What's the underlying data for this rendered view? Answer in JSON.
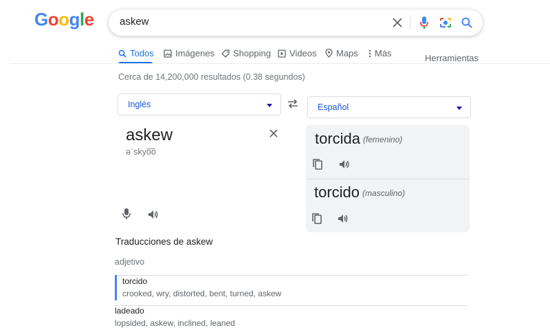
{
  "logo": {
    "letters": [
      "G",
      "o",
      "o",
      "g",
      "l",
      "e"
    ],
    "colors": [
      "#4285f4",
      "#ea4335",
      "#fbbc05",
      "#4285f4",
      "#34a853",
      "#ea4335"
    ]
  },
  "search": {
    "query": "askew",
    "icons": [
      "clear-icon",
      "mic-icon",
      "lens-icon",
      "search-icon"
    ]
  },
  "tabs": [
    {
      "label": "Todos",
      "icon": "search-icon",
      "active": true
    },
    {
      "label": "Imágenes",
      "icon": "image-icon"
    },
    {
      "label": "Shopping",
      "icon": "tag-icon"
    },
    {
      "label": "Videos",
      "icon": "play-icon"
    },
    {
      "label": "Maps",
      "icon": "pin-icon"
    },
    {
      "label": "Más",
      "icon": "more-vert-icon"
    }
  ],
  "tools_label": "Herramientas",
  "result_stats": "Cerca de 14,200,000 resultados (0.38 segundos)",
  "translator": {
    "source_lang": "Inglés",
    "target_lang": "Español",
    "source_word": "askew",
    "phonetic": "əˈskyo͞o",
    "results": [
      {
        "word": "torcida",
        "gender": "(femenino)"
      },
      {
        "word": "torcido",
        "gender": "(masculino)"
      }
    ],
    "accent": "#1a73e8"
  },
  "translations": {
    "heading": "Traducciones de askew",
    "pos": "adjetivo",
    "entries": [
      {
        "word": "torcido",
        "synonyms": "crooked, wry, distorted, bent, turned, askew",
        "selected": true
      },
      {
        "word": "ladeado",
        "synonyms": "lopsided, askew, inclined, leaned"
      }
    ]
  }
}
